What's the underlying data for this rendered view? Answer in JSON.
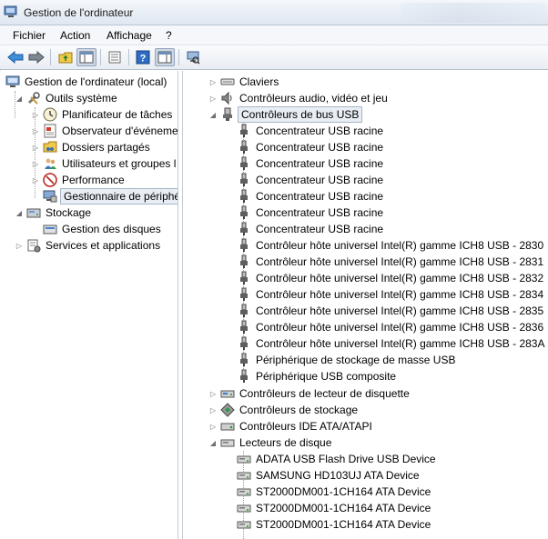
{
  "window": {
    "title": "Gestion de l'ordinateur"
  },
  "menu": {
    "items": [
      "Fichier",
      "Action",
      "Affichage",
      "?"
    ]
  },
  "toolbar": {
    "buttons": [
      "back-icon",
      "forward-icon",
      "up-folder-icon",
      "console-tree-icon",
      "properties-icon",
      "help-icon",
      "show-hide-icon",
      "scan-hardware-icon"
    ]
  },
  "left_tree": {
    "root": "Gestion de l'ordinateur (local)",
    "outils": "Outils système",
    "planificateur": "Planificateur de tâches",
    "observateur": "Observateur d'événeme",
    "dossiers": "Dossiers partagés",
    "utilisateurs": "Utilisateurs et groupes l",
    "performance": "Performance",
    "gestionnaire": "Gestionnaire de périphé",
    "stockage": "Stockage",
    "gestion_disques": "Gestion des disques",
    "services": "Services et applications"
  },
  "right_tree": {
    "claviers": "Claviers",
    "audio": "Contrôleurs audio, vidéo et jeu",
    "usb": "Contrôleurs de bus USB",
    "usb_items": [
      "Concentrateur USB racine",
      "Concentrateur USB racine",
      "Concentrateur USB racine",
      "Concentrateur USB racine",
      "Concentrateur USB racine",
      "Concentrateur USB racine",
      "Concentrateur USB racine",
      "Contrôleur hôte universel Intel(R) gamme ICH8 USB - 2830",
      "Contrôleur hôte universel Intel(R) gamme ICH8 USB - 2831",
      "Contrôleur hôte universel Intel(R) gamme ICH8 USB - 2832",
      "Contrôleur hôte universel Intel(R) gamme ICH8 USB - 2834",
      "Contrôleur hôte universel Intel(R) gamme ICH8 USB - 2835",
      "Contrôleur hôte universel Intel(R) gamme ICH8 USB - 2836",
      "Contrôleur hôte universel Intel(R) gamme ICH8 USB - 283A",
      "Périphérique de stockage de masse USB",
      "Périphérique USB composite"
    ],
    "disquette": "Contrôleurs de lecteur de disquette",
    "stockage": "Contrôleurs de stockage",
    "ide": "Contrôleurs IDE ATA/ATAPI",
    "lecteurs": "Lecteurs de disque",
    "disk_items": [
      "ADATA USB Flash Drive USB Device",
      "SAMSUNG HD103UJ ATA Device",
      "ST2000DM001-1CH164 ATA Device",
      "ST2000DM001-1CH164 ATA Device",
      "ST2000DM001-1CH164 ATA Device"
    ]
  },
  "colors": {
    "selection_bg": "#e9eef5",
    "selection_border": "#a7b5c7",
    "guide": "#a0a0a0"
  }
}
